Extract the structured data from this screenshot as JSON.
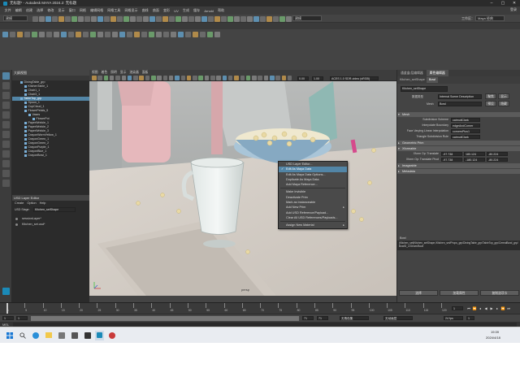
{
  "window": {
    "title": "无标题* - Autodesk MAYA 2024.2: 无标题",
    "workspace_label": "工作区：",
    "workspace_value": "Maya 经典"
  },
  "menubar": {
    "items": [
      "文件",
      "编辑",
      "创建",
      "选择",
      "修改",
      "显示",
      "窗口",
      "网格",
      "编辑网格",
      "网格工具",
      "网格显示",
      "曲线",
      "曲面",
      "变形",
      "UV",
      "生成",
      "缓存",
      "Arnold",
      "帮助"
    ],
    "mode": "建模",
    "signin": "登录"
  },
  "outliner": {
    "title": "大纲视图",
    "rows": [
      {
        "label": "DiningTable_grp",
        "indent": 2,
        "selected": false
      },
      {
        "label": "KitchenTable_1",
        "indent": 3,
        "selected": false
      },
      {
        "label": "Chair1_1",
        "indent": 3,
        "selected": false
      },
      {
        "label": "Chair3_1",
        "indent": 3,
        "selected": false
      },
      {
        "label": "TableTop_grp",
        "indent": 2,
        "selected": true
      },
      {
        "label": "Spoon_1",
        "indent": 3,
        "selected": false
      },
      {
        "label": "CupCloud_1",
        "indent": 3,
        "selected": false
      },
      {
        "label": "FlowerPetals_5",
        "indent": 3,
        "selected": false
      },
      {
        "label": "Vases",
        "indent": 4,
        "selected": false
      },
      {
        "label": "FlowerPot",
        "indent": 5,
        "selected": false
      },
      {
        "label": "PaperWrinkle_1",
        "indent": 3,
        "selected": false
      },
      {
        "label": "PaperWrinkle_2",
        "indent": 3,
        "selected": false
      },
      {
        "label": "PaperWrinkle_3",
        "indent": 3,
        "selected": false
      },
      {
        "label": "CrayonWormYellow_1",
        "indent": 3,
        "selected": false
      },
      {
        "label": "CrayonGreen_1",
        "indent": 3,
        "selected": false
      },
      {
        "label": "CrayonGreen_2",
        "indent": 3,
        "selected": false
      },
      {
        "label": "CrayonPurple_1",
        "indent": 3,
        "selected": false
      },
      {
        "label": "CrayonBlue_1",
        "indent": 3,
        "selected": false
      },
      {
        "label": "CrayonBowl_1",
        "indent": 3,
        "selected": false
      }
    ]
  },
  "usd_layer_editor": {
    "title": "USD Layer Editor",
    "menu": [
      "Create",
      "Option",
      "Help"
    ],
    "stage_label": "USD Stage:",
    "stage_value": "Kitchen_setShape",
    "layers": [
      "sessionLayer*",
      "Kitchen_set.usd*"
    ]
  },
  "viewport": {
    "menu": [
      "视图",
      "着色",
      "照明",
      "显示",
      "渲染器",
      "面板"
    ],
    "fields": [
      "0.00",
      "1.00"
    ],
    "colorspace": "ACES 1.0 SDR-video (sRGB)"
  },
  "context_menu": {
    "items": [
      {
        "label": "USD Layer Editor...",
        "highlighted": false,
        "checked": false
      },
      {
        "label": "Edit As Maya Data",
        "highlighted": true,
        "checked": true
      },
      {
        "label": "Edit As Maya Data Options...",
        "highlighted": false,
        "checked": false
      },
      {
        "label": "Duplicate As Maya Data",
        "highlighted": false,
        "checked": false
      },
      {
        "label": "Add Maya Reference...",
        "highlighted": false,
        "checked": false
      },
      {
        "sep": true
      },
      {
        "label": "Make Invisible",
        "highlighted": false,
        "checked": false
      },
      {
        "label": "Deactivate Prim",
        "highlighted": false,
        "checked": false
      },
      {
        "label": "Mark as Instanceable",
        "highlighted": false,
        "checked": false
      },
      {
        "label": "Add New Prim",
        "highlighted": false,
        "checked": false,
        "submenu": true
      },
      {
        "label": "Add USD Reference/Payload...",
        "highlighted": false,
        "checked": false
      },
      {
        "label": "Clear All USD References/Payloads...",
        "highlighted": false,
        "checked": false
      },
      {
        "sep": true
      },
      {
        "label": "Assign New Material",
        "highlighted": false,
        "checked": false,
        "submenu": true
      }
    ]
  },
  "attribute_editor": {
    "tabs": [
      "通道盒/层编辑器",
      "属性编辑器"
    ],
    "node_tab1": "Kitchen_setShape",
    "node_tab2": "Bowl",
    "desc_label": "数据类型",
    "desc_value": "Internal Scene Description",
    "mesh_label": "Mesh",
    "mesh_value": "Bowl",
    "focus_btn": "聚焦",
    "preset_btn": "预设",
    "show_btn": "显示",
    "hide_btn": "隐藏",
    "sections": [
      {
        "label": "Mesh",
        "open": true
      },
      {
        "label": "Geometric Prim",
        "open": false
      },
      {
        "label": "Xformable",
        "open": true
      },
      {
        "label": "Imageable",
        "open": false
      },
      {
        "label": "Metadata",
        "open": false
      }
    ],
    "mesh_rows": [
      {
        "label": "Subdivision Scheme",
        "value": "catmullClark"
      },
      {
        "label": "Interpolate Boundary",
        "value": "edgeAndCorner"
      },
      {
        "label": "Face Varying Linear Interpolation",
        "value": "cornersPlus1"
      },
      {
        "label": "Triangle Subdivision Rule",
        "value": "catmullClark"
      }
    ],
    "xform_rows": [
      {
        "label": "Xform Op: Translate",
        "values": [
          "-97.738",
          "180.124",
          "-80.224"
        ]
      },
      {
        "label": "Xform Op: Translate Pivot",
        "values": [
          "-97.738",
          "-180.124",
          "-80.224"
        ]
      }
    ],
    "path_label": "Bowl",
    "path_text": "|Kitchen_set|Kitchen_setShape,/Kitchen_set/Props_grp/DiningTable_grp/TableTop_grp/CerealBowl_grp/BowlD_1/Geom/Bowl",
    "bottom_buttons": [
      "选择",
      "加载属性",
      "复制选项卡"
    ]
  },
  "timeline": {
    "ticks": [
      "1",
      "5",
      "10",
      "15",
      "20",
      "25",
      "30",
      "35",
      "40",
      "45",
      "50",
      "55",
      "60",
      "65",
      "70",
      "75",
      "80",
      "85",
      "90",
      "95",
      "100",
      "105",
      "110",
      "115",
      "120"
    ],
    "current_frame": "1",
    "range_start": "1",
    "range_inner_start": "1",
    "range_inner_end": "71",
    "range_end": "71",
    "anim_layer": "无角色集",
    "no_anim": "无动画层",
    "fps": "24 fps",
    "playback_speed": "1"
  },
  "cmdline": {
    "label": "MEL"
  },
  "taskbar": {
    "time": "19:39",
    "date": "2024/4/18"
  }
}
